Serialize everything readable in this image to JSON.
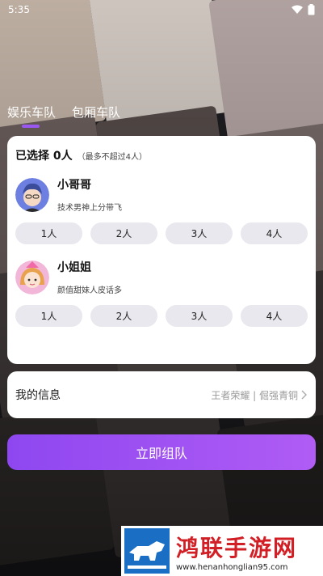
{
  "status_bar": {
    "time": "5:35"
  },
  "tabs": [
    {
      "label": "娱乐车队",
      "active": true
    },
    {
      "label": "包厢车队",
      "active": false
    }
  ],
  "selection": {
    "title": "已选择 0人",
    "subtitle": "（最多不超过4人）",
    "groups": [
      {
        "name": "小哥哥",
        "desc": "技术男神上分带飞",
        "options": [
          "1人",
          "2人",
          "3人",
          "4人"
        ]
      },
      {
        "name": "小姐姐",
        "desc": "颜值甜妹人皮话多",
        "options": [
          "1人",
          "2人",
          "3人",
          "4人"
        ]
      }
    ]
  },
  "my_info": {
    "label": "我的信息",
    "value": "王者荣耀 | 倔强青铜"
  },
  "cta": {
    "label": "立即组队"
  },
  "watermark": {
    "name": "鸿联手游网",
    "url": "www.henanhonglian95.com"
  },
  "colors": {
    "accent": "#9a57f2",
    "button_gradient_start": "#8e47f0",
    "button_gradient_end": "#b05cf5",
    "pill_bg": "#e8e8ee",
    "watermark_red": "#d11f25",
    "watermark_blue": "#1a6ec4"
  },
  "icons": [
    "wifi-icon",
    "battery-icon",
    "chevron-right-icon"
  ]
}
